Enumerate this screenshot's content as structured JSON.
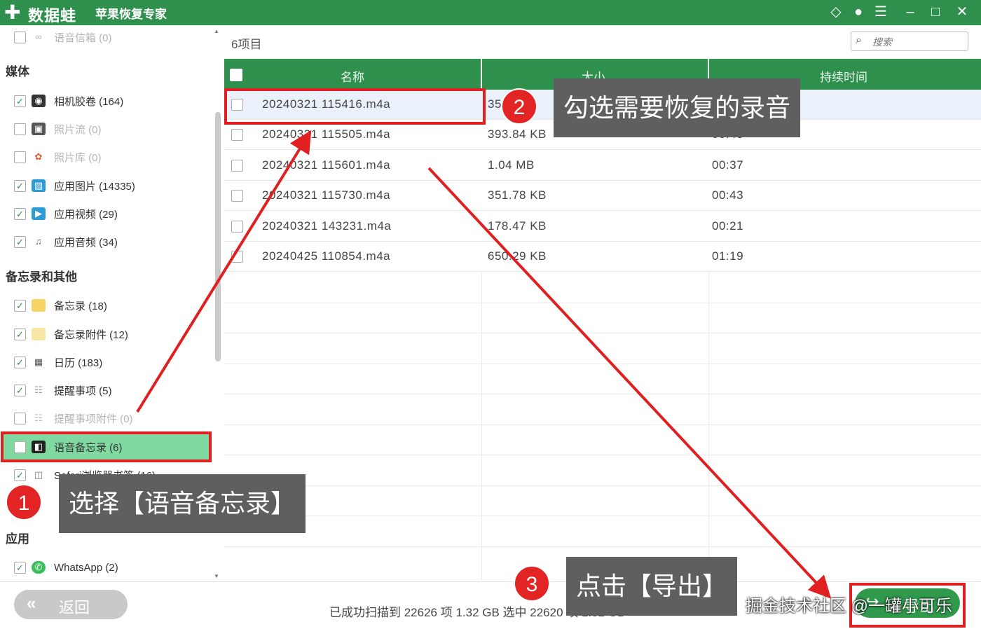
{
  "titlebar": {
    "brand": "数据蛙",
    "subtitle": "苹果恢复专家",
    "icons": [
      "diamond-icon",
      "chat-icon",
      "feedback-icon",
      "minimize-icon",
      "maximize-icon",
      "close-icon"
    ]
  },
  "sidebar": {
    "top_item": "语音信箱 (0)",
    "sections": {
      "media": "媒体",
      "memos_other": "备忘录和其他",
      "apps": "应用"
    },
    "media_items": [
      {
        "label": "相机胶卷 (164)",
        "checked": true
      },
      {
        "label": "照片流 (0)",
        "checked": false
      },
      {
        "label": "照片库 (0)",
        "checked": false
      },
      {
        "label": "应用图片 (14335)",
        "checked": true
      },
      {
        "label": "应用视频 (29)",
        "checked": true
      },
      {
        "label": "应用音频 (34)",
        "checked": true
      }
    ],
    "memo_items": [
      {
        "label": "备忘录 (18)",
        "checked": true
      },
      {
        "label": "备忘录附件 (12)",
        "checked": true
      },
      {
        "label": "日历 (183)",
        "checked": true
      },
      {
        "label": "提醒事项 (5)",
        "checked": true
      },
      {
        "label": "提醒事项附件 (0)",
        "checked": false
      },
      {
        "label": "语音备忘录 (6)",
        "checked": false,
        "selected": true
      },
      {
        "label": "Safari浏览器书签 (16)",
        "checked": true
      }
    ],
    "app_items": [
      {
        "label": "WhatsApp (2)",
        "checked": true
      }
    ]
  },
  "main": {
    "count_label": "6项目",
    "search_placeholder": "搜索",
    "columns": {
      "name": "名称",
      "size": "大小",
      "duration": "持续时间"
    },
    "rows": [
      {
        "name": "20240321 115416.m4a",
        "size": "35",
        "duration": ""
      },
      {
        "name": "20240321 115505.m4a",
        "size": "393.84 KB",
        "duration": "00:48"
      },
      {
        "name": "20240321 115601.m4a",
        "size": "1.04 MB",
        "duration": "00:37"
      },
      {
        "name": "20240321 115730.m4a",
        "size": "351.78 KB",
        "duration": "00:43"
      },
      {
        "name": "20240321 143231.m4a",
        "size": "178.47 KB",
        "duration": "00:21"
      },
      {
        "name": "20240425 110854.m4a",
        "size": "650.29 KB",
        "duration": "01:19"
      }
    ]
  },
  "bottom": {
    "back_label": "返回",
    "status_text": "已成功扫描到 22626 项 1.32 GB   选中 22620 项 1.32 GB",
    "export_label": "导出"
  },
  "annotations": {
    "step1_num": "1",
    "step1_text": "选择【语音备忘录】",
    "step2_num": "2",
    "step2_text": "勾选需要恢复的录音",
    "step3_num": "3",
    "step3_text": "点击【导出】",
    "watermark": "掘金技术社区 @一罐小可乐"
  },
  "colors": {
    "brand_green": "#2f8f4c",
    "selected_green": "#7fd9a0",
    "annotation_red": "#e02020",
    "callout_gray": "#5f5f5f"
  }
}
